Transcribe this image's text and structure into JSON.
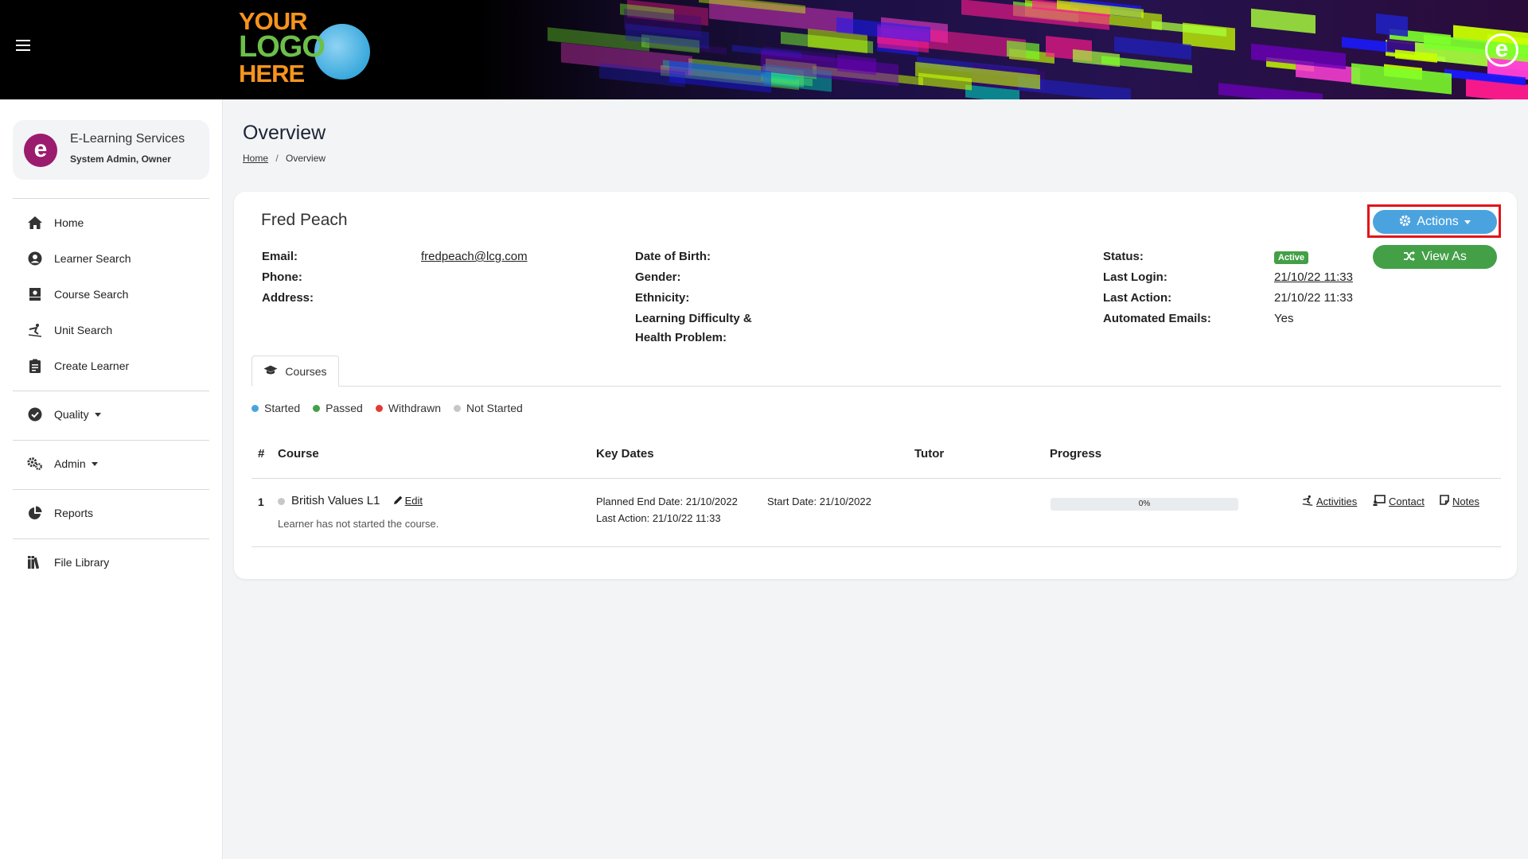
{
  "header": {
    "logo_line1": "YOUR",
    "logo_line2": "LOGO",
    "logo_line3": "HERE",
    "brand_glyph": "e",
    "menu_icon": "hamburger-icon"
  },
  "sidebar": {
    "org_name": "E-Learning Services",
    "org_role": "System Admin, Owner",
    "items": [
      {
        "label": "Home",
        "icon": "home-icon"
      },
      {
        "label": "Learner Search",
        "icon": "user-circle-icon"
      },
      {
        "label": "Course Search",
        "icon": "teacher-icon"
      },
      {
        "label": "Unit Search",
        "icon": "skier-icon"
      },
      {
        "label": "Create Learner",
        "icon": "clipboard-icon"
      },
      {
        "label": "Quality",
        "icon": "check-circle-icon"
      },
      {
        "label": "Admin",
        "icon": "cogs-icon"
      },
      {
        "label": "Reports",
        "icon": "pie-chart-icon"
      },
      {
        "label": "File Library",
        "icon": "books-icon"
      }
    ]
  },
  "page": {
    "title": "Overview",
    "breadcrumb_home": "Home",
    "breadcrumb_sep": "/",
    "breadcrumb_current": "Overview"
  },
  "learner": {
    "name": "Fred Peach",
    "email_label": "Email:",
    "email": "fredpeach@lcg.com",
    "phone_label": "Phone:",
    "address_label": "Address:",
    "dob_label": "Date of Birth:",
    "gender_label": "Gender:",
    "ethnicity_label": "Ethnicity:",
    "ldhp_label_1": "Learning Difficulty &",
    "ldhp_label_2": "Health Problem:",
    "status_label": "Status:",
    "status": "Active",
    "last_login_label": "Last Login:",
    "last_login": "21/10/22 11:33",
    "last_action_label": "Last Action:",
    "last_action": "21/10/22 11:33",
    "auto_emails_label": "Automated Emails:",
    "auto_emails": "Yes"
  },
  "buttons": {
    "actions": "Actions",
    "view_as": "View As"
  },
  "tabs": [
    {
      "label": "Courses"
    }
  ],
  "legend": [
    {
      "label": "Started",
      "color": "#4aa3df"
    },
    {
      "label": "Passed",
      "color": "#43a047"
    },
    {
      "label": "Withdrawn",
      "color": "#e53935"
    },
    {
      "label": "Not Started",
      "color": "#c7c7c7"
    }
  ],
  "table": {
    "headers": [
      "#",
      "Course",
      "Key Dates",
      "Tutor",
      "Progress"
    ],
    "rows": [
      {
        "num": "1",
        "course": "British Values L1",
        "edit": "Edit",
        "note": "Learner has not started the course.",
        "planned_end": "Planned End Date: 21/10/2022",
        "start_date": "Start Date: 21/10/2022",
        "last_action": "Last Action: 21/10/22 11:33",
        "tutor": "",
        "progress_text": "0%",
        "progress": 0,
        "links": [
          "Activities",
          "Contact",
          "Notes"
        ]
      }
    ]
  },
  "colors": {
    "accent_blue": "#4aa3df",
    "accent_green": "#43a047",
    "highlight_red": "#e2141b"
  }
}
